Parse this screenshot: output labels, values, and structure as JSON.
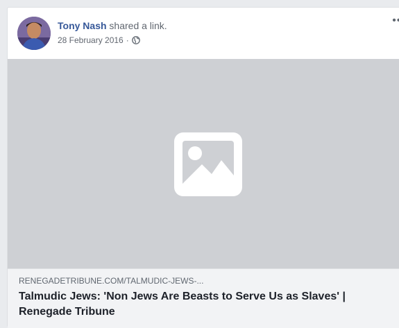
{
  "post": {
    "author_name": "Tony Nash",
    "action_text": " shared a link.",
    "date": "28 February 2016",
    "separator": "·",
    "privacy_icon": "globe-icon",
    "more_label": "•••"
  },
  "media": {
    "placeholder_icon": "image-placeholder-icon"
  },
  "link": {
    "domain": "RENEGADETRIBUNE.COM/TALMUDIC-JEWS-...",
    "title": "Talmudic Jews: 'Non Jews Are Beasts to Serve Us as Slaves' | Renegade Tribune"
  },
  "colors": {
    "author_link": "#365899",
    "image_bg": "#ced0d4",
    "link_box_bg": "#f2f3f5"
  }
}
